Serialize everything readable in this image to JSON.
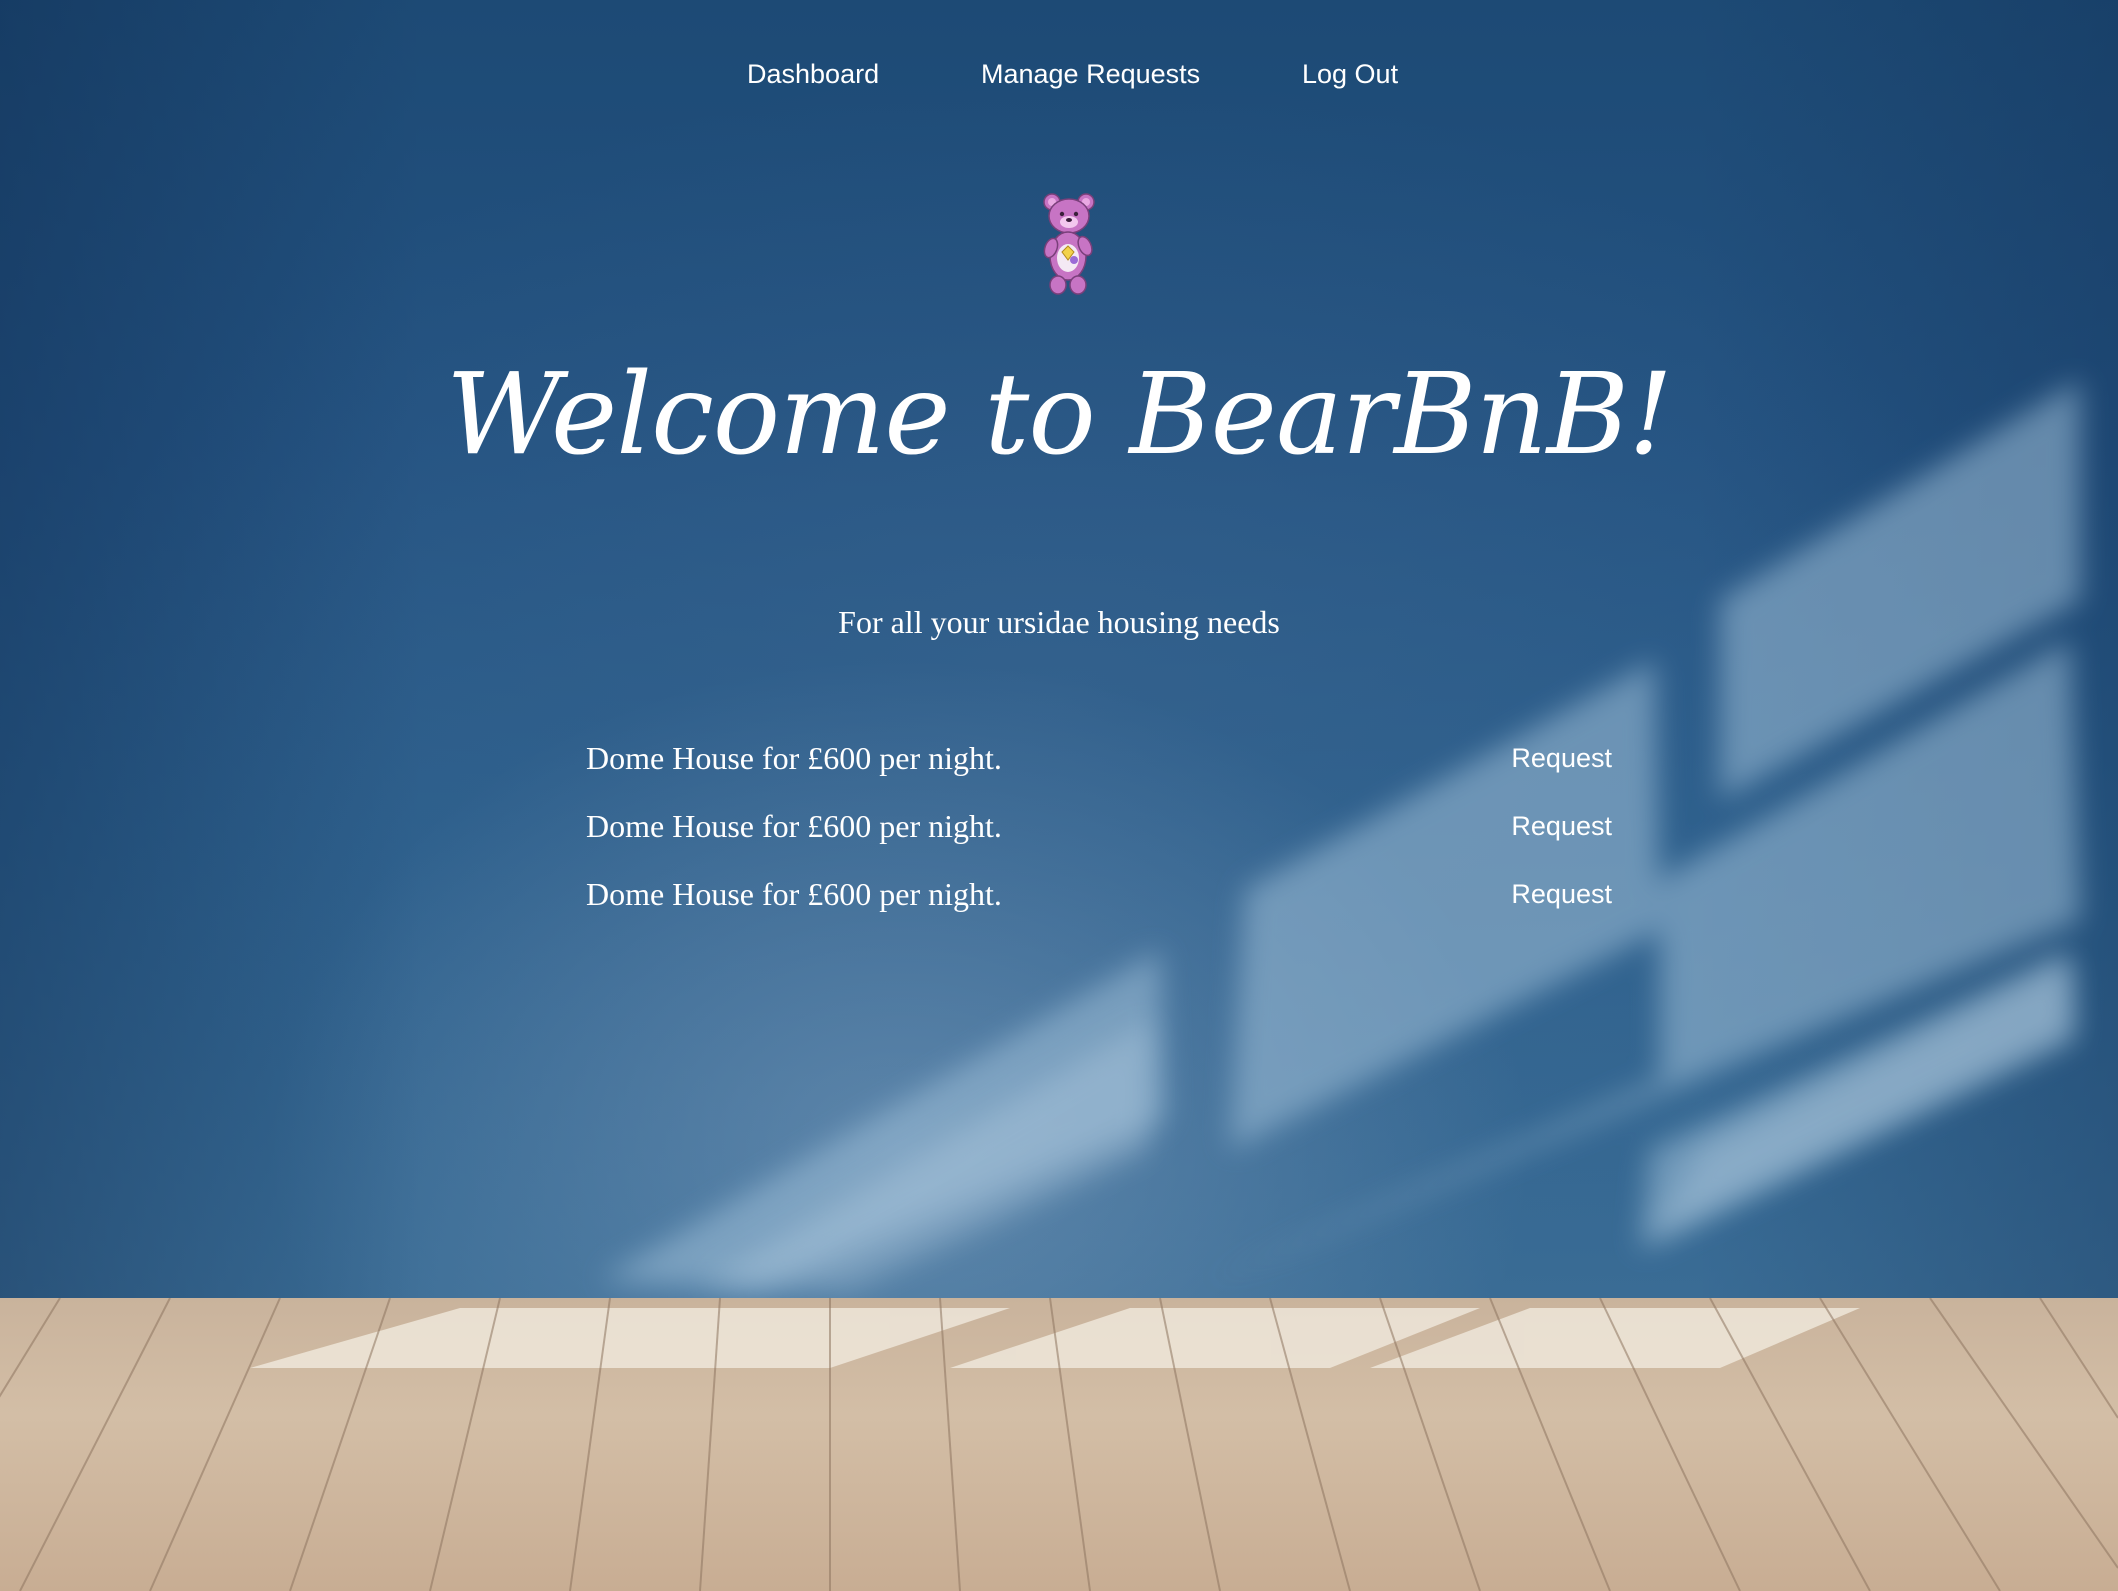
{
  "nav": {
    "items": [
      {
        "label": "Dashboard"
      },
      {
        "label": "Manage Requests"
      },
      {
        "label": "Log Out"
      }
    ]
  },
  "logo": {
    "icon": "bear-icon"
  },
  "header": {
    "title": "Welcome to BearBnB!",
    "subtitle": "For all your ursidae housing needs"
  },
  "listings": [
    {
      "text": "Dome House for £600 per night.",
      "action": "Request"
    },
    {
      "text": "Dome House for £600 per night.",
      "action": "Request"
    },
    {
      "text": "Dome House for £600 per night.",
      "action": "Request"
    }
  ],
  "colors": {
    "wall": "#245382",
    "floor": "#d3bea6",
    "text": "#ffffff",
    "bear": "#c774c4"
  }
}
